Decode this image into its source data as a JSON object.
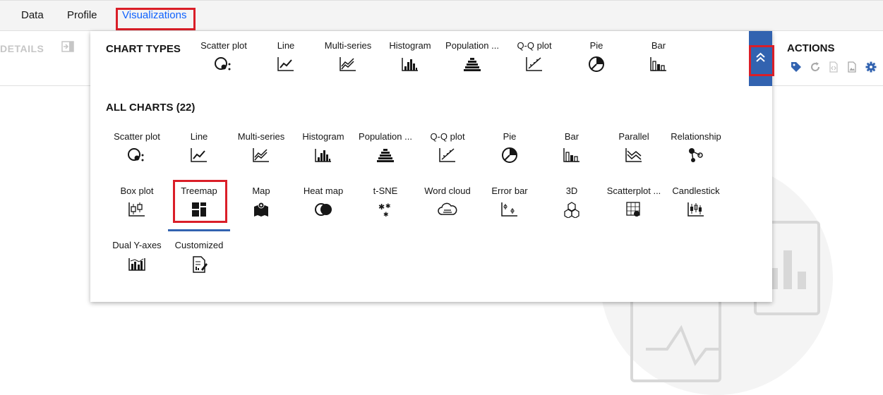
{
  "tabs": {
    "data": "Data",
    "profile": "Profile",
    "visualizations": "Visualizations"
  },
  "left_panel": {
    "title": "DETAILS"
  },
  "right_panel": {
    "title": "ACTIONS",
    "icons": [
      "tag-icon",
      "refresh-icon",
      "code-icon",
      "image-icon",
      "settings-icon"
    ]
  },
  "colors": {
    "accent": "#3263b0",
    "highlight": "#da1e28",
    "link": "#0f62fe"
  },
  "chart_types": {
    "title": "CHART TYPES",
    "items": [
      "Scatter plot",
      "Line",
      "Multi-series",
      "Histogram",
      "Population ...",
      "Q-Q plot",
      "Pie",
      "Bar"
    ]
  },
  "all_charts": {
    "title": "ALL CHARTS (22)",
    "items": [
      "Scatter plot",
      "Line",
      "Multi-series",
      "Histogram",
      "Population ...",
      "Q-Q plot",
      "Pie",
      "Bar",
      "Parallel",
      "Relationship",
      "Box plot",
      "Treemap",
      "Map",
      "Heat map",
      "t-SNE",
      "Word cloud",
      "Error bar",
      "3D",
      "Scatterplot ...",
      "Candlestick",
      "Dual Y-axes",
      "Customized"
    ],
    "selected": "Treemap"
  }
}
